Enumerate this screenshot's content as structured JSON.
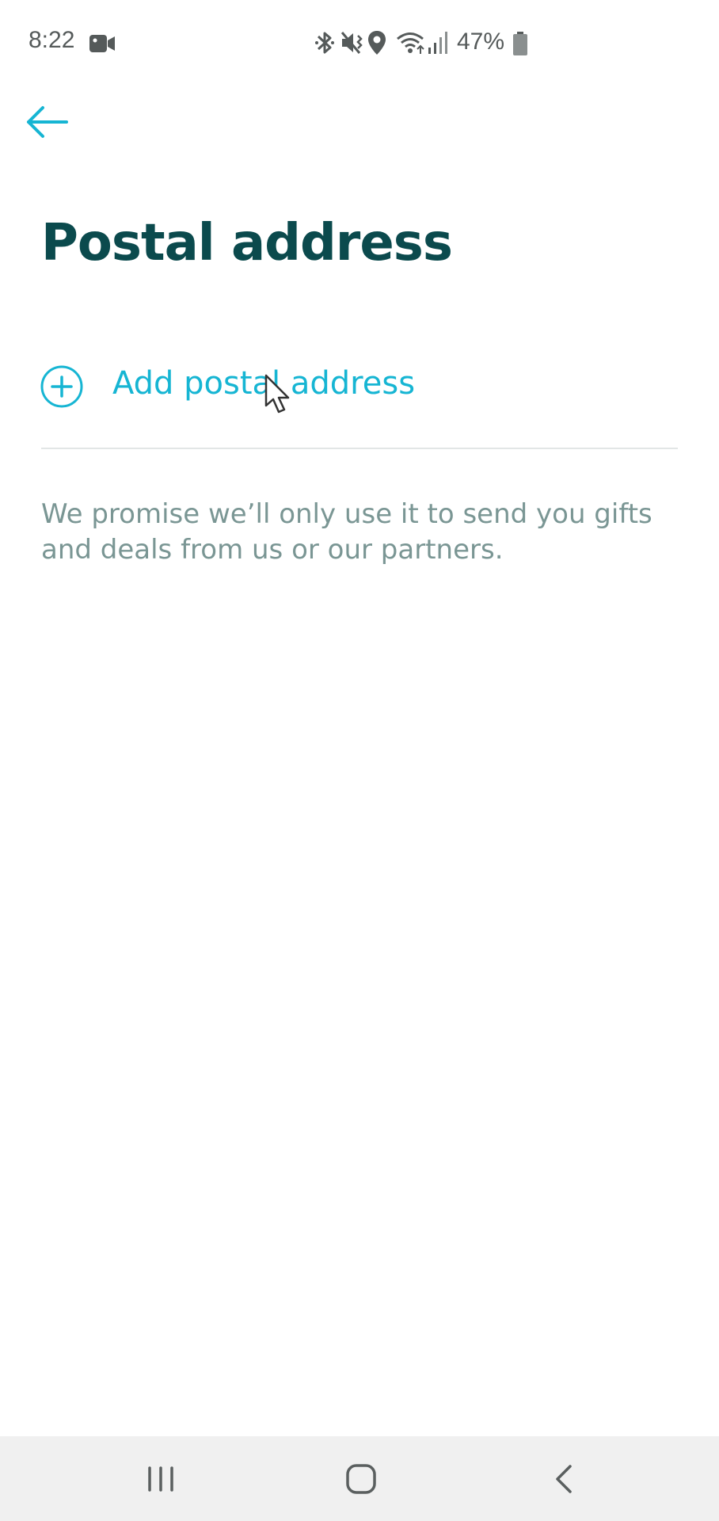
{
  "status_bar": {
    "time": "8:22",
    "battery": "47%",
    "icons": [
      "video-camera-icon",
      "bluetooth-icon",
      "mute-icon",
      "location-icon",
      "wifi-icon",
      "signal-icon",
      "battery-icon"
    ]
  },
  "header": {
    "back_icon": "arrow-left-icon"
  },
  "page": {
    "title": "Postal address",
    "add_address": {
      "icon": "plus-circle-icon",
      "label": "Add postal address"
    },
    "promise_text": "We promise we’ll only use it to send you gifts and deals from us or our partners."
  },
  "nav_bar": {
    "buttons": [
      "recent-apps-icon",
      "home-icon",
      "back-icon"
    ]
  },
  "colors": {
    "accent": "#16b5d3",
    "title": "#0b4a4d",
    "body_text": "#7a9694",
    "divider": "#e2e6e6",
    "status_text": "#555a5a",
    "nav_bar_bg": "#f0f0f0"
  }
}
